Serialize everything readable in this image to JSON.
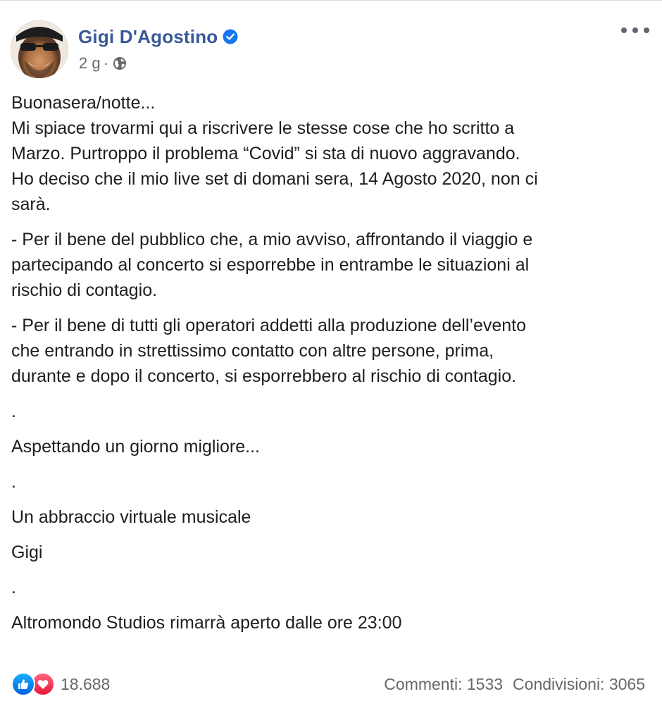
{
  "post": {
    "author": "Gigi D'Agostino",
    "time": "2 g",
    "dot": "·",
    "paragraphs": [
      {
        "lines": [
          "Buonasera/notte...",
          "Mi spiace trovarmi qui a riscrivere le stesse cose che ho scritto a",
          "Marzo. Purtroppo il problema “Covid” si sta di nuovo aggravando.",
          "Ho deciso che il mio live set di domani sera, 14 Agosto 2020, non ci",
          "sarà."
        ]
      },
      {
        "lines": [
          "- Per il bene del pubblico che, a mio avviso, affrontando il viaggio e",
          "partecipando al concerto si esporrebbe in entrambe le situazioni al",
          "rischio di contagio."
        ]
      },
      {
        "lines": [
          "- Per il bene di tutti gli operatori addetti alla produzione dell’evento",
          "che entrando in strettissimo contatto con altre persone, prima,",
          "durante e dopo il concerto, si esporrebbero al rischio di contagio."
        ]
      },
      {
        "lines": [
          "."
        ]
      },
      {
        "lines": [
          "Aspettando un giorno migliore..."
        ]
      },
      {
        "lines": [
          "."
        ]
      },
      {
        "lines": [
          "Un abbraccio virtuale musicale"
        ]
      },
      {
        "lines": [
          "Gigi"
        ]
      },
      {
        "lines": [
          "."
        ]
      },
      {
        "lines": [
          "Altromondo Studios rimarrà aperto dalle ore 23:00"
        ]
      }
    ]
  },
  "footer": {
    "reactions_count": "18.688",
    "comments": "Commenti: 1533",
    "shares": "Condivisioni: 3065"
  },
  "icons": {
    "verified": "verified-badge-icon",
    "privacy": "globe-icon",
    "more": "more-options-icon",
    "like": "like-reaction-icon",
    "love": "love-reaction-icon"
  },
  "colors": {
    "author_name": "#385898",
    "verified": "#1877f2",
    "meta": "#65676b",
    "text": "#1c1e21",
    "like": "#1877f2",
    "love": "#f33e58"
  }
}
